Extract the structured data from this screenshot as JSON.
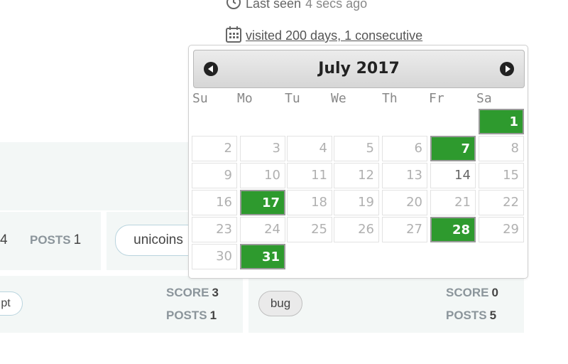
{
  "profile": {
    "last_seen_label": "Last seen",
    "last_seen_value": "4 secs ago",
    "visited_text": " visited 200 days, 1 consecutive"
  },
  "cards": {
    "row1_num": "4",
    "row1_posts_label": "POSTS",
    "row1_posts_value": "1",
    "tag_unicoins": "unicoins",
    "row2_left_tag": "pt",
    "row2_left_score_label": "SCORE",
    "row2_left_score_value": "3",
    "row2_left_posts_label": "POSTS",
    "row2_left_posts_value": "1",
    "tag_bug": "bug",
    "row2_right_score_label": "SCORE",
    "row2_right_score_value": "0",
    "row2_right_posts_label": "POSTS",
    "row2_right_posts_value": "5"
  },
  "datepicker": {
    "title": "July 2017",
    "weekdays": [
      "Su",
      "Mo",
      "Tu",
      "We",
      "Th",
      "Fr",
      "Sa"
    ],
    "days": [
      "1",
      "2",
      "3",
      "4",
      "5",
      "6",
      "7",
      "8",
      "9",
      "10",
      "11",
      "12",
      "13",
      "14",
      "15",
      "16",
      "17",
      "18",
      "19",
      "20",
      "21",
      "22",
      "23",
      "24",
      "25",
      "26",
      "27",
      "28",
      "29",
      "30",
      "31"
    ],
    "highlighted": [
      "1",
      "7",
      "17",
      "28",
      "31"
    ]
  }
}
